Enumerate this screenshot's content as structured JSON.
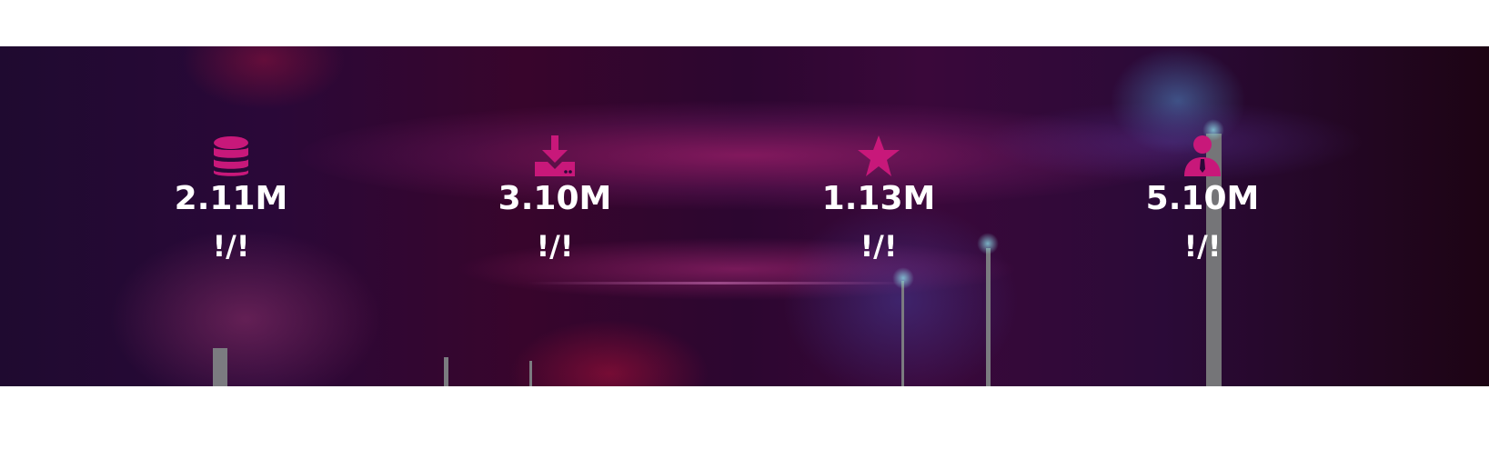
{
  "accent_color": "#c8187a",
  "stats": [
    {
      "icon": "database-icon",
      "value": "2.11M",
      "label": "!/!"
    },
    {
      "icon": "download-icon",
      "value": "3.10M",
      "label": "!/!"
    },
    {
      "icon": "star-icon",
      "value": "1.13M",
      "label": "!/!"
    },
    {
      "icon": "user-tie-icon",
      "value": "5.10M",
      "label": "!/!"
    }
  ]
}
